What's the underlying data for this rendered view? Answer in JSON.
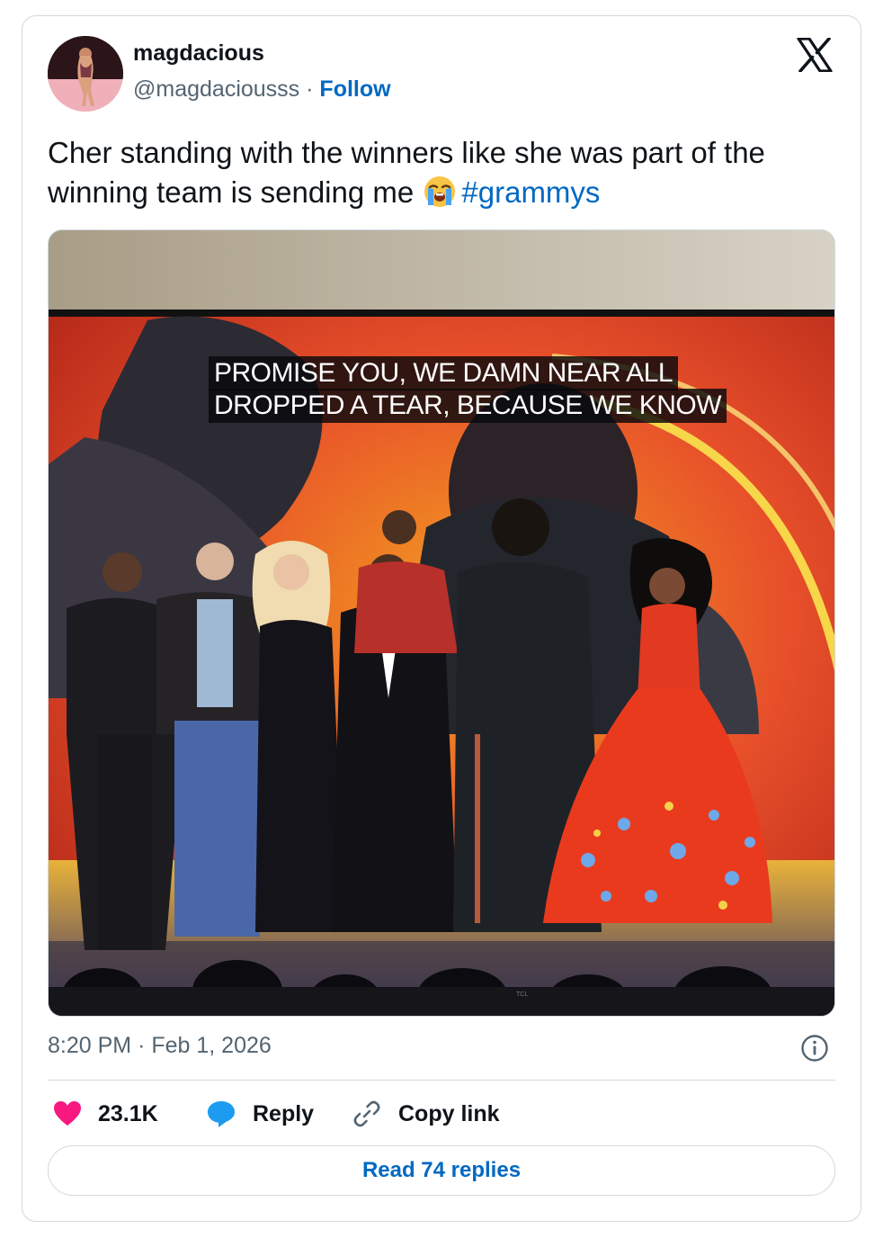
{
  "author": {
    "display_name": "magdacious",
    "handle": "@magdaciousss",
    "separator": "·",
    "follow_label": "Follow"
  },
  "tweet": {
    "text_main": "Cher standing with the winners like she was part of the winning team is sending me",
    "emoji": "loudly-crying-face-emoji",
    "hashtag": "#grammys"
  },
  "media": {
    "caption_line_1": "PROMISE YOU, WE DAMN NEAR ALL",
    "caption_line_2": "DROPPED A TEAR, BECAUSE WE KNOW",
    "tv_brand": "TCL"
  },
  "meta": {
    "time": "8:20 PM",
    "separator": "·",
    "date": "Feb 1, 2026"
  },
  "actions": {
    "like_count": "23.1K",
    "reply_label": "Reply",
    "copy_link_label": "Copy link"
  },
  "footer": {
    "read_replies_label": "Read 74 replies"
  },
  "colors": {
    "link_blue": "#0069c2",
    "heart_pink": "#f91880",
    "reply_blue": "#1d9bf0",
    "muted_gray": "#536471"
  },
  "icons": [
    "x-logo-icon",
    "heart-icon",
    "reply-bubble-icon",
    "link-icon",
    "info-icon"
  ]
}
